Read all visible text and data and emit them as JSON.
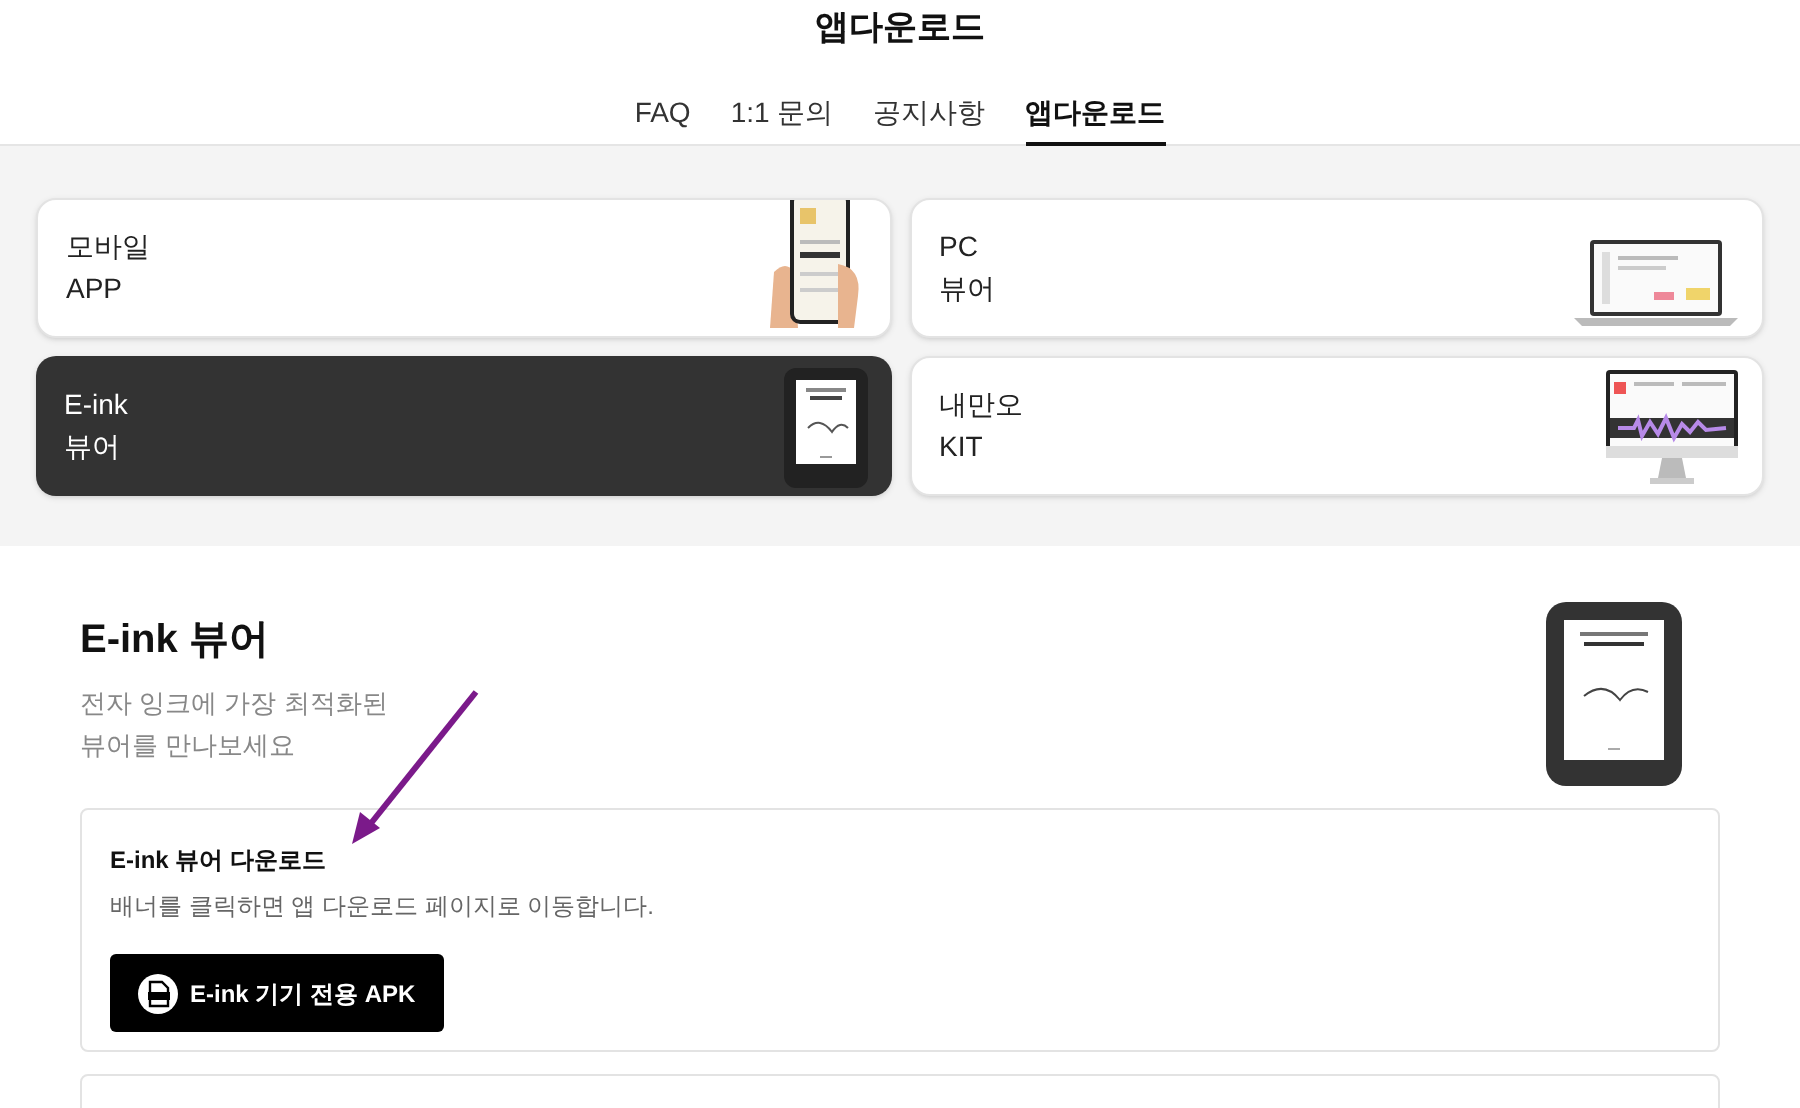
{
  "page_title": "앱다운로드",
  "tabs": [
    {
      "label": "FAQ",
      "selected": false
    },
    {
      "label": "1:1 문의",
      "selected": false
    },
    {
      "label": "공지사항",
      "selected": false
    },
    {
      "label": "앱다운로드",
      "selected": true
    }
  ],
  "app_cards": [
    {
      "line1": "모바일",
      "line2": "APP",
      "kind": "phone",
      "selected": false
    },
    {
      "line1": "PC",
      "line2": "뷰어",
      "kind": "laptop",
      "selected": false
    },
    {
      "line1": "E-ink",
      "line2": "뷰어",
      "kind": "ereader",
      "selected": true
    },
    {
      "line1": "내만오",
      "line2": "KIT",
      "kind": "monitor",
      "selected": false
    }
  ],
  "section": {
    "title": "E-ink 뷰어",
    "subtitle_lines": [
      "전자 잉크에 가장 최적화된",
      "뷰어를 만나보세요"
    ]
  },
  "download_box": {
    "title": "E-ink 뷰어 다운로드",
    "description": "배너를 클릭하면 앱 다운로드 페이지로 이동합니다.",
    "button": "E-ink 기기 전용 APK"
  }
}
